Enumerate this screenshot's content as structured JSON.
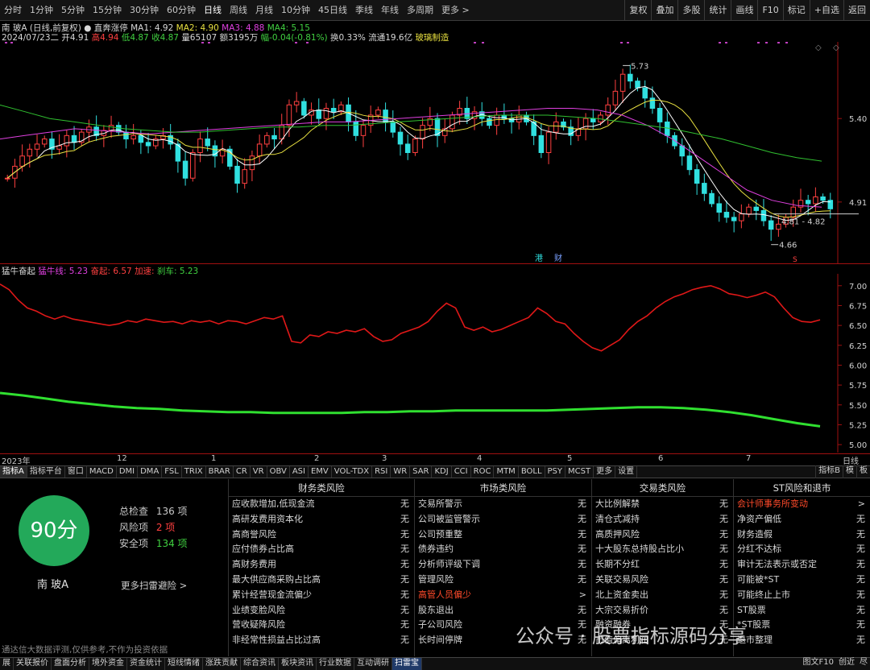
{
  "periods": [
    {
      "label": "分时",
      "active": false
    },
    {
      "label": "1分钟",
      "active": false
    },
    {
      "label": "5分钟",
      "active": false
    },
    {
      "label": "15分钟",
      "active": false
    },
    {
      "label": "30分钟",
      "active": false
    },
    {
      "label": "60分钟",
      "active": false
    },
    {
      "label": "日线",
      "active": true
    },
    {
      "label": "周线",
      "active": false
    },
    {
      "label": "月线",
      "active": false
    },
    {
      "label": "10分钟",
      "active": false
    },
    {
      "label": "45日线",
      "active": false
    },
    {
      "label": "季线",
      "active": false
    },
    {
      "label": "年线",
      "active": false
    },
    {
      "label": "多周期",
      "active": false
    },
    {
      "label": "更多 >",
      "active": false
    }
  ],
  "toolbar": [
    "复权",
    "叠加",
    "多股",
    "统计",
    "画线",
    "F10",
    "标记",
    "+自选",
    "返回"
  ],
  "info": {
    "name": "南 玻A",
    "period": "(日线,前复权)",
    "status_icon": "dot-icon",
    "status": "直奔涨停",
    "ma1": "MA1: 4.92",
    "ma2": "MA2: 4.90",
    "ma3": "MA3: 4.88",
    "ma4": "MA4: 5.15",
    "date": "2024/07/23二",
    "open": "开4.91",
    "high": "高4.94",
    "low": "低4.87",
    "close": "收4.87",
    "volume": "量65107",
    "amount": "额3195万",
    "change": "幅-0.04(-0.81%)",
    "turnover": "换0.33%",
    "float_cap": "流通19.6亿",
    "industry": "玻璃制造"
  },
  "price_axis": [
    {
      "label": "5.40",
      "value": 5.4
    },
    {
      "label": "4.91",
      "value": 4.91
    }
  ],
  "price_annotations": {
    "high": {
      "label": "5.73",
      "value": 5.73
    },
    "low": {
      "label": "4.66",
      "value": 4.66
    },
    "range": "4.81 - 4.82",
    "marks": [
      "港",
      "财"
    ],
    "s_mark": "S"
  },
  "indicator": {
    "name": "猛牛奋起",
    "line1": "猛牛线: 5.23",
    "line2": "奋起: 6.57",
    "line3": "加速: ",
    "line4": "刹车: 5.23"
  },
  "sub_axis": [
    {
      "label": "7.00",
      "value": 7.0
    },
    {
      "label": "6.75",
      "value": 6.75
    },
    {
      "label": "6.50",
      "value": 6.5
    },
    {
      "label": "6.25",
      "value": 6.25
    },
    {
      "label": "6.00",
      "value": 6.0
    },
    {
      "label": "5.75",
      "value": 5.75
    },
    {
      "label": "5.50",
      "value": 5.5
    },
    {
      "label": "5.25",
      "value": 5.25
    },
    {
      "label": "5.00",
      "value": 5.0
    }
  ],
  "time_labels": [
    "2023年",
    "12",
    "1",
    "2",
    "3",
    "4",
    "5",
    "6",
    "7",
    "日线"
  ],
  "indicator_tabs": [
    "指标A",
    "指标平台",
    "窗口",
    "MACD",
    "DMI",
    "DMA",
    "FSL",
    "TRIX",
    "BRAR",
    "CR",
    "VR",
    "OBV",
    "ASI",
    "EMV",
    "VOL-TDX",
    "RSI",
    "WR",
    "SAR",
    "KDJ",
    "CCI",
    "ROC",
    "MTM",
    "BOLL",
    "PSY",
    "MCST",
    "更多",
    "设置"
  ],
  "indicator_tabs_right": [
    "指标B",
    "模",
    "板"
  ],
  "risk": {
    "score": "90分",
    "stock_name": "南 玻A",
    "total_label": "总检查",
    "total_value": "136 项",
    "risk_label": "风险项",
    "risk_value": "2 项",
    "safe_label": "安全项",
    "safe_value": "134 项",
    "more": "更多扫雷避险 >",
    "disclaimer": "通达信大数据评测,仅供参考,不作为投资依据",
    "columns": [
      {
        "title": "财务类风险",
        "items": [
          {
            "name": "应收款增加,低现金流",
            "value": "无",
            "hl": false
          },
          {
            "name": "高研发费用资本化",
            "value": "无",
            "hl": false
          },
          {
            "name": "高商誉风险",
            "value": "无",
            "hl": false
          },
          {
            "name": "应付债券占比高",
            "value": "无",
            "hl": false
          },
          {
            "name": "高财务费用",
            "value": "无",
            "hl": false
          },
          {
            "name": "最大供应商采购占比高",
            "value": "无",
            "hl": false
          },
          {
            "name": "累计经营现金流偏少",
            "value": "无",
            "hl": false
          },
          {
            "name": "业绩变脸风险",
            "value": "无",
            "hl": false
          },
          {
            "name": "营收疑降风险",
            "value": "无",
            "hl": false
          },
          {
            "name": "非经常性损益占比过高",
            "value": "无",
            "hl": false
          }
        ]
      },
      {
        "title": "市场类风险",
        "items": [
          {
            "name": "交易所警示",
            "value": "无",
            "hl": false
          },
          {
            "name": "公司被监管警示",
            "value": "无",
            "hl": false
          },
          {
            "name": "公司预重整",
            "value": "无",
            "hl": false
          },
          {
            "name": "债券违约",
            "value": "无",
            "hl": false
          },
          {
            "name": "分析师评级下调",
            "value": "无",
            "hl": false
          },
          {
            "name": "管理风险",
            "value": "无",
            "hl": false
          },
          {
            "name": "高管人员偏少",
            "value": ">",
            "hl": true
          },
          {
            "name": "股东退出",
            "value": "无",
            "hl": false
          },
          {
            "name": "子公司风险",
            "value": "无",
            "hl": false
          },
          {
            "name": "长时间停牌",
            "value": "无",
            "hl": false
          }
        ]
      },
      {
        "title": "交易类风险",
        "items": [
          {
            "name": "大比例解禁",
            "value": "无",
            "hl": false
          },
          {
            "name": "清仓式减持",
            "value": "无",
            "hl": false
          },
          {
            "name": "高质押风险",
            "value": "无",
            "hl": false
          },
          {
            "name": "十大股东总持股占比小",
            "value": "无",
            "hl": false
          },
          {
            "name": "长期不分红",
            "value": "无",
            "hl": false
          },
          {
            "name": "关联交易风险",
            "value": "无",
            "hl": false
          },
          {
            "name": "北上资金卖出",
            "value": "无",
            "hl": false
          },
          {
            "name": "大宗交易折价",
            "value": "无",
            "hl": false
          },
          {
            "name": "融资融券",
            "value": "无",
            "hl": false
          },
          {
            "name": "市值偏离利润",
            "value": "无",
            "hl": false
          }
        ]
      },
      {
        "title": "ST风险和退市",
        "items": [
          {
            "name": "会计师事务所变动",
            "value": ">",
            "hl": true
          },
          {
            "name": "净资产偏低",
            "value": "无",
            "hl": false
          },
          {
            "name": "财务造假",
            "value": "无",
            "hl": false
          },
          {
            "name": "分红不达标",
            "value": "无",
            "hl": false
          },
          {
            "name": "审计无法表示或否定",
            "value": "无",
            "hl": false
          },
          {
            "name": "可能被*ST",
            "value": "无",
            "hl": false
          },
          {
            "name": "可能终止上市",
            "value": "无",
            "hl": false
          },
          {
            "name": "ST股票",
            "value": "无",
            "hl": false
          },
          {
            "name": "*ST股票",
            "value": "无",
            "hl": false
          },
          {
            "name": "退市整理",
            "value": "无",
            "hl": false
          }
        ]
      }
    ]
  },
  "bottom_tabs": [
    "展",
    "关联报价",
    "盘面分析",
    "境外资金",
    "资金统计",
    "短线情绪",
    "涨跌贡献",
    "综合资讯",
    "板块资讯",
    "行业数据",
    "互动调研",
    "扫雷宝"
  ],
  "bottom_active": "扫雷宝",
  "bottom_right": [
    "图文F10",
    "创近",
    "尽"
  ],
  "watermark": "公众号 · 股票指标源码分享",
  "colors": {
    "up": "#ff4040",
    "down": "#30e0e0",
    "ma1": "#ffffff",
    "ma2": "#e8e040",
    "ma3": "#e040e0",
    "ma4": "#30c030",
    "indicator_red": "#e01818",
    "indicator_green": "#30e030",
    "score_bg": "#23a95a"
  },
  "chart_data": [
    {
      "type": "candlestick",
      "ylim": [
        4.55,
        5.85
      ],
      "ma_series": [
        "MA1",
        "MA2",
        "MA3",
        "MA4"
      ],
      "close_path": [
        5.05,
        5.12,
        5.18,
        5.22,
        5.25,
        5.28,
        5.22,
        5.24,
        5.3,
        5.26,
        5.32,
        5.35,
        5.3,
        5.33,
        5.36,
        5.32,
        5.28,
        5.3,
        5.26,
        5.24,
        5.28,
        5.3,
        5.25,
        5.15,
        5.05,
        5.2,
        5.28,
        5.24,
        5.18,
        5.22,
        5.12,
        5.02,
        5.1,
        5.18,
        5.25,
        5.3,
        5.28,
        5.36,
        5.48,
        5.5,
        5.42,
        5.45,
        5.4,
        5.46,
        5.44,
        5.48,
        5.38,
        5.3,
        5.36,
        5.42,
        5.45,
        5.38,
        5.32,
        5.25,
        5.2,
        5.28,
        5.36,
        5.4,
        5.3,
        5.34,
        5.42,
        5.46,
        5.4,
        5.44,
        5.4,
        5.36,
        5.42,
        5.4,
        5.38,
        5.42,
        5.38,
        5.3,
        5.2,
        5.32,
        5.38,
        5.35,
        5.3,
        5.34,
        5.4,
        5.38,
        5.42,
        5.48,
        5.56,
        5.66,
        5.62,
        5.58,
        5.52,
        5.46,
        5.38,
        5.3,
        5.24,
        5.18,
        5.1,
        5.02,
        4.96,
        4.9,
        4.85,
        4.82,
        4.8,
        4.84,
        4.88,
        4.86,
        4.8,
        4.75,
        4.78,
        4.82,
        4.88,
        4.92,
        4.9,
        4.94,
        4.92,
        4.87
      ],
      "ma4_path": [
        5.48,
        5.44,
        5.4,
        5.38,
        5.36,
        5.34,
        5.33,
        5.32,
        5.32,
        5.33,
        5.34,
        5.35,
        5.35,
        5.36,
        5.36,
        5.37,
        5.38,
        5.39,
        5.4,
        5.41,
        5.42,
        5.42,
        5.42,
        5.41,
        5.4,
        5.38,
        5.36,
        5.34,
        5.31,
        5.28,
        5.24,
        5.2,
        5.17,
        5.15
      ],
      "ma3_path": [
        5.28,
        5.3,
        5.32,
        5.34,
        5.33,
        5.32,
        5.31,
        5.32,
        5.33,
        5.34,
        5.35,
        5.36,
        5.37,
        5.38,
        5.38,
        5.39,
        5.4,
        5.41,
        5.42,
        5.43,
        5.44,
        5.45,
        5.46,
        5.46,
        5.45,
        5.42,
        5.36,
        5.28,
        5.18,
        5.08,
        4.98,
        4.92,
        4.89,
        4.88
      ]
    },
    {
      "type": "line",
      "ylim": [
        4.9,
        7.15
      ],
      "series": [
        {
          "name": "奋起",
          "color": "#e01818",
          "values": [
            7.02,
            6.95,
            6.82,
            6.72,
            6.68,
            6.62,
            6.58,
            6.62,
            6.58,
            6.56,
            6.54,
            6.52,
            6.5,
            6.52,
            6.56,
            6.54,
            6.58,
            6.56,
            6.54,
            6.55,
            6.52,
            6.56,
            6.54,
            6.56,
            6.52,
            6.56,
            6.55,
            6.52,
            6.56,
            6.6,
            6.58,
            6.62,
            6.3,
            6.28,
            6.38,
            6.36,
            6.42,
            6.4,
            6.44,
            6.42,
            6.46,
            6.36,
            6.3,
            6.32,
            6.4,
            6.44,
            6.48,
            6.55,
            6.68,
            6.78,
            6.72,
            6.48,
            6.44,
            6.48,
            6.42,
            6.45,
            6.5,
            6.55,
            6.6,
            6.72,
            6.65,
            6.55,
            6.52,
            6.4,
            6.3,
            6.22,
            6.18,
            6.25,
            6.32,
            6.45,
            6.55,
            6.62,
            6.72,
            6.8,
            6.86,
            6.9,
            6.95,
            6.98,
            7.0,
            6.96,
            6.9,
            6.88,
            6.85,
            6.88,
            6.92,
            6.86,
            6.72,
            6.6,
            6.55,
            6.54,
            6.57
          ]
        },
        {
          "name": "猛牛线",
          "color": "#30e030",
          "values": [
            5.65,
            5.62,
            5.58,
            5.54,
            5.51,
            5.48,
            5.46,
            5.45,
            5.43,
            5.42,
            5.41,
            5.41,
            5.4,
            5.4,
            5.4,
            5.4,
            5.41,
            5.41,
            5.42,
            5.42,
            5.43,
            5.43,
            5.43,
            5.43,
            5.43,
            5.44,
            5.45,
            5.46,
            5.47,
            5.47,
            5.46,
            5.44,
            5.41,
            5.37,
            5.32,
            5.27,
            5.23
          ]
        }
      ]
    }
  ]
}
